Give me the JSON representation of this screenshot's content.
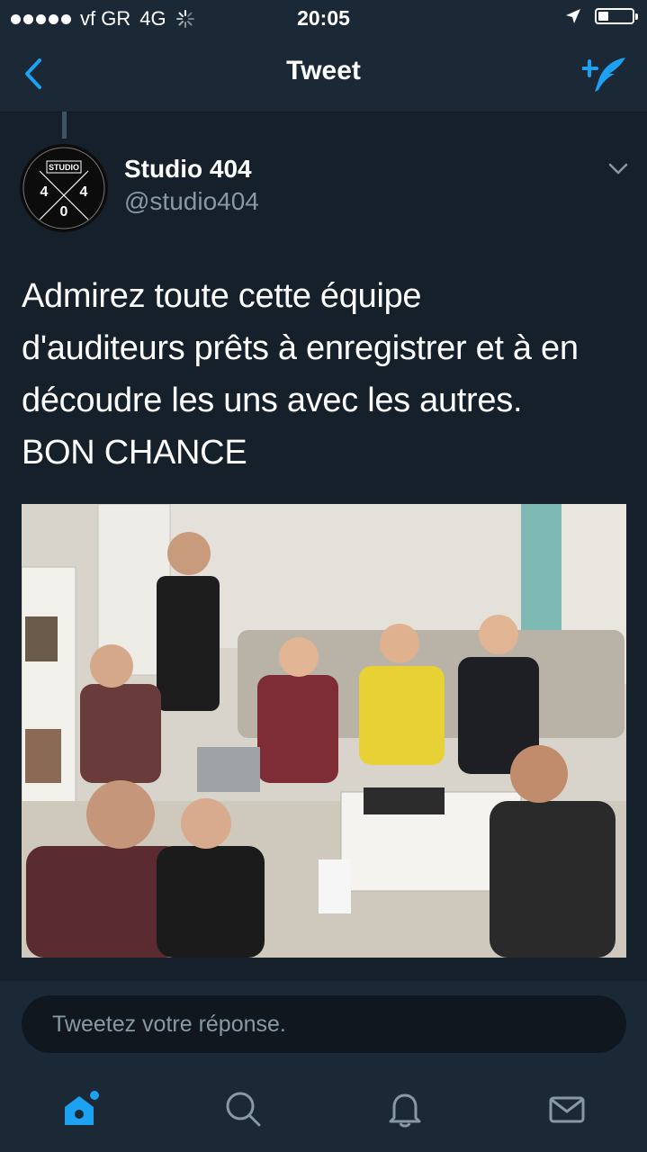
{
  "status_bar": {
    "carrier": "vf GR",
    "network": "4G",
    "time": "20:05",
    "battery_level": 0.3
  },
  "nav": {
    "title": "Tweet",
    "back_icon": "chevron-left-icon",
    "compose_icon": "compose-tweet-icon"
  },
  "tweet": {
    "author_name": "Studio 404",
    "author_handle": "@studio404",
    "avatar": {
      "top_text": "STUDIO",
      "digits": [
        "4",
        "0",
        "4"
      ]
    },
    "text": "Admirez toute cette équipe\nd'auditeurs prêts à enregistrer et à en\ndécoudre les uns avec les autres.\nBON CHANCE",
    "media": "photo"
  },
  "reply": {
    "placeholder": "Tweetez votre réponse."
  },
  "tabbar": {
    "items": [
      {
        "name": "home",
        "icon": "home-icon",
        "active": true
      },
      {
        "name": "search",
        "icon": "search-icon",
        "active": false
      },
      {
        "name": "notifications",
        "icon": "bell-icon",
        "active": false
      },
      {
        "name": "messages",
        "icon": "envelope-icon",
        "active": false
      }
    ]
  },
  "colors": {
    "background": "#15202b",
    "bar": "#1b2836",
    "accent": "#1da1f2",
    "secondary_text": "#8899a6"
  }
}
